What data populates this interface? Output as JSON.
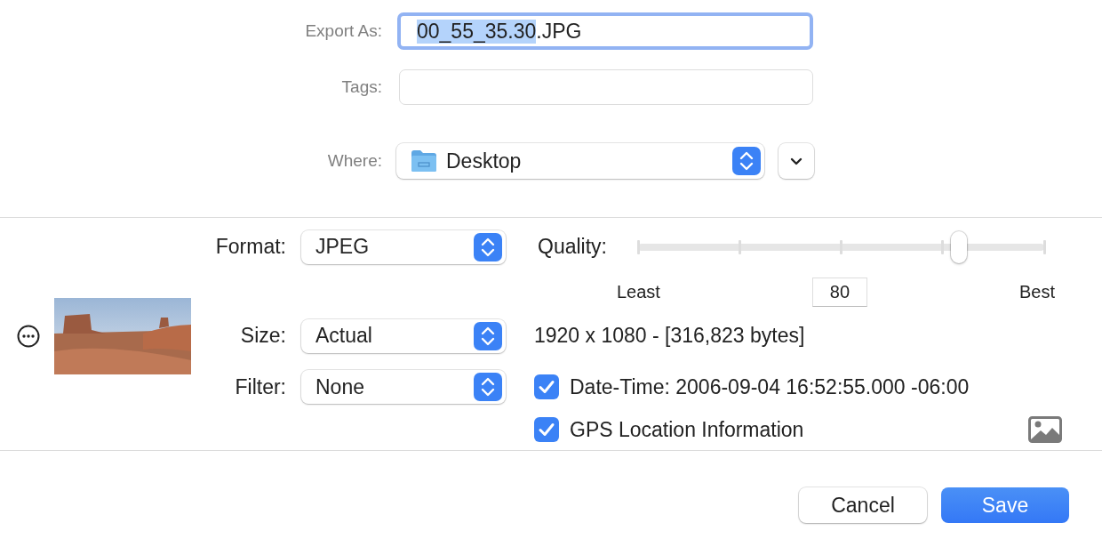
{
  "export_as": {
    "label": "Export As:",
    "focused": true,
    "value_parts": [
      {
        "text": "00_55_35.30",
        "selected": true
      },
      {
        "text": ".JPG",
        "selected": false
      }
    ]
  },
  "tags": {
    "label": "Tags:"
  },
  "where": {
    "label": "Where:",
    "value": "Desktop",
    "expanded": false
  },
  "options": {
    "format": {
      "label": "Format:",
      "value": "JPEG"
    },
    "quality": {
      "label": "Quality:",
      "level": 0.79,
      "min_label": "Least",
      "value": "80",
      "max_label": "Best"
    },
    "size": {
      "label": "Size:",
      "value": "Actual"
    },
    "info": "1920 x 1080 - [316,823 bytes]",
    "filter": {
      "label": "Filter:",
      "value": "None"
    },
    "metadata": [
      {
        "label": "Date-Time: 2006-09-04 16:52:55.000 -06:00",
        "checked": true
      },
      {
        "label": "GPS Location Information",
        "checked": true
      }
    ]
  },
  "buttons": [
    {
      "label": "Cancel",
      "kind": "secondary"
    },
    {
      "label": "Save",
      "kind": "default"
    }
  ]
}
